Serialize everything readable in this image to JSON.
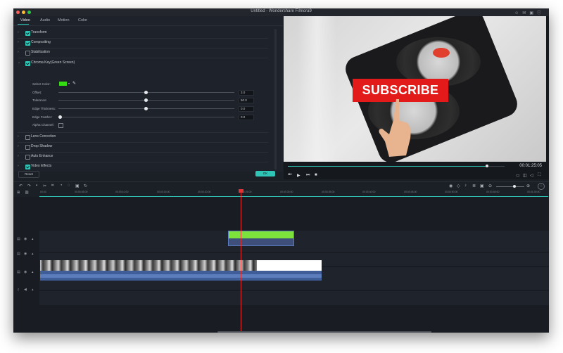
{
  "window": {
    "title": "Untitled - Wondershare Filmora9",
    "traffic_lights": [
      "#ff5f57",
      "#febc2e",
      "#28c840"
    ]
  },
  "editor": {
    "tabs": [
      "Video",
      "Audio",
      "Motion",
      "Color"
    ],
    "active_tab": "Video",
    "sections_top": [
      {
        "label": "Transform",
        "checked": true
      },
      {
        "label": "Compositing",
        "checked": true
      },
      {
        "label": "Stabilization",
        "checked": false
      }
    ],
    "chroma": {
      "label": "Chroma Key(Green Screen)",
      "checked": true,
      "select_color_label": "Select Color:",
      "select_color_value": "#33dd11",
      "params": [
        {
          "label": "Offset:",
          "value": "3.0",
          "fraction": 0.49
        },
        {
          "label": "Tolerance:",
          "value": "50.0",
          "fraction": 0.49
        },
        {
          "label": "Edge Thickness:",
          "value": "0.0",
          "fraction": 0.49
        },
        {
          "label": "Edge Feather:",
          "value": "0.0",
          "fraction": 0.0
        }
      ],
      "alpha_channel_label": "Alpha Channel:"
    },
    "sections_bottom": [
      {
        "label": "Lens Correction",
        "checked": false
      },
      {
        "label": "Drop Shadow",
        "checked": false
      },
      {
        "label": "Auto Enhance",
        "checked": false
      },
      {
        "label": "Video Effects",
        "checked": true
      }
    ],
    "reset_label": "Reset",
    "ok_label": "OK"
  },
  "preview": {
    "subscribe_text": "SUBSCRIBE",
    "timecode": "00:01:25:05",
    "progress_fraction": 0.92
  },
  "timeline": {
    "ticks": [
      "00:00",
      "00:00:05:00",
      "00:00:10:00",
      "00:00:15:00",
      "00:00:20:00",
      "00:00:25:00",
      "00:00:30:00",
      "00:00:35:00",
      "00:00:40:00",
      "00:00:45:00",
      "00:00:50:00",
      "00:00:55:00",
      "00:01:00:00"
    ],
    "accent": "#2ec4b6",
    "playhead_color": "#e23434"
  }
}
